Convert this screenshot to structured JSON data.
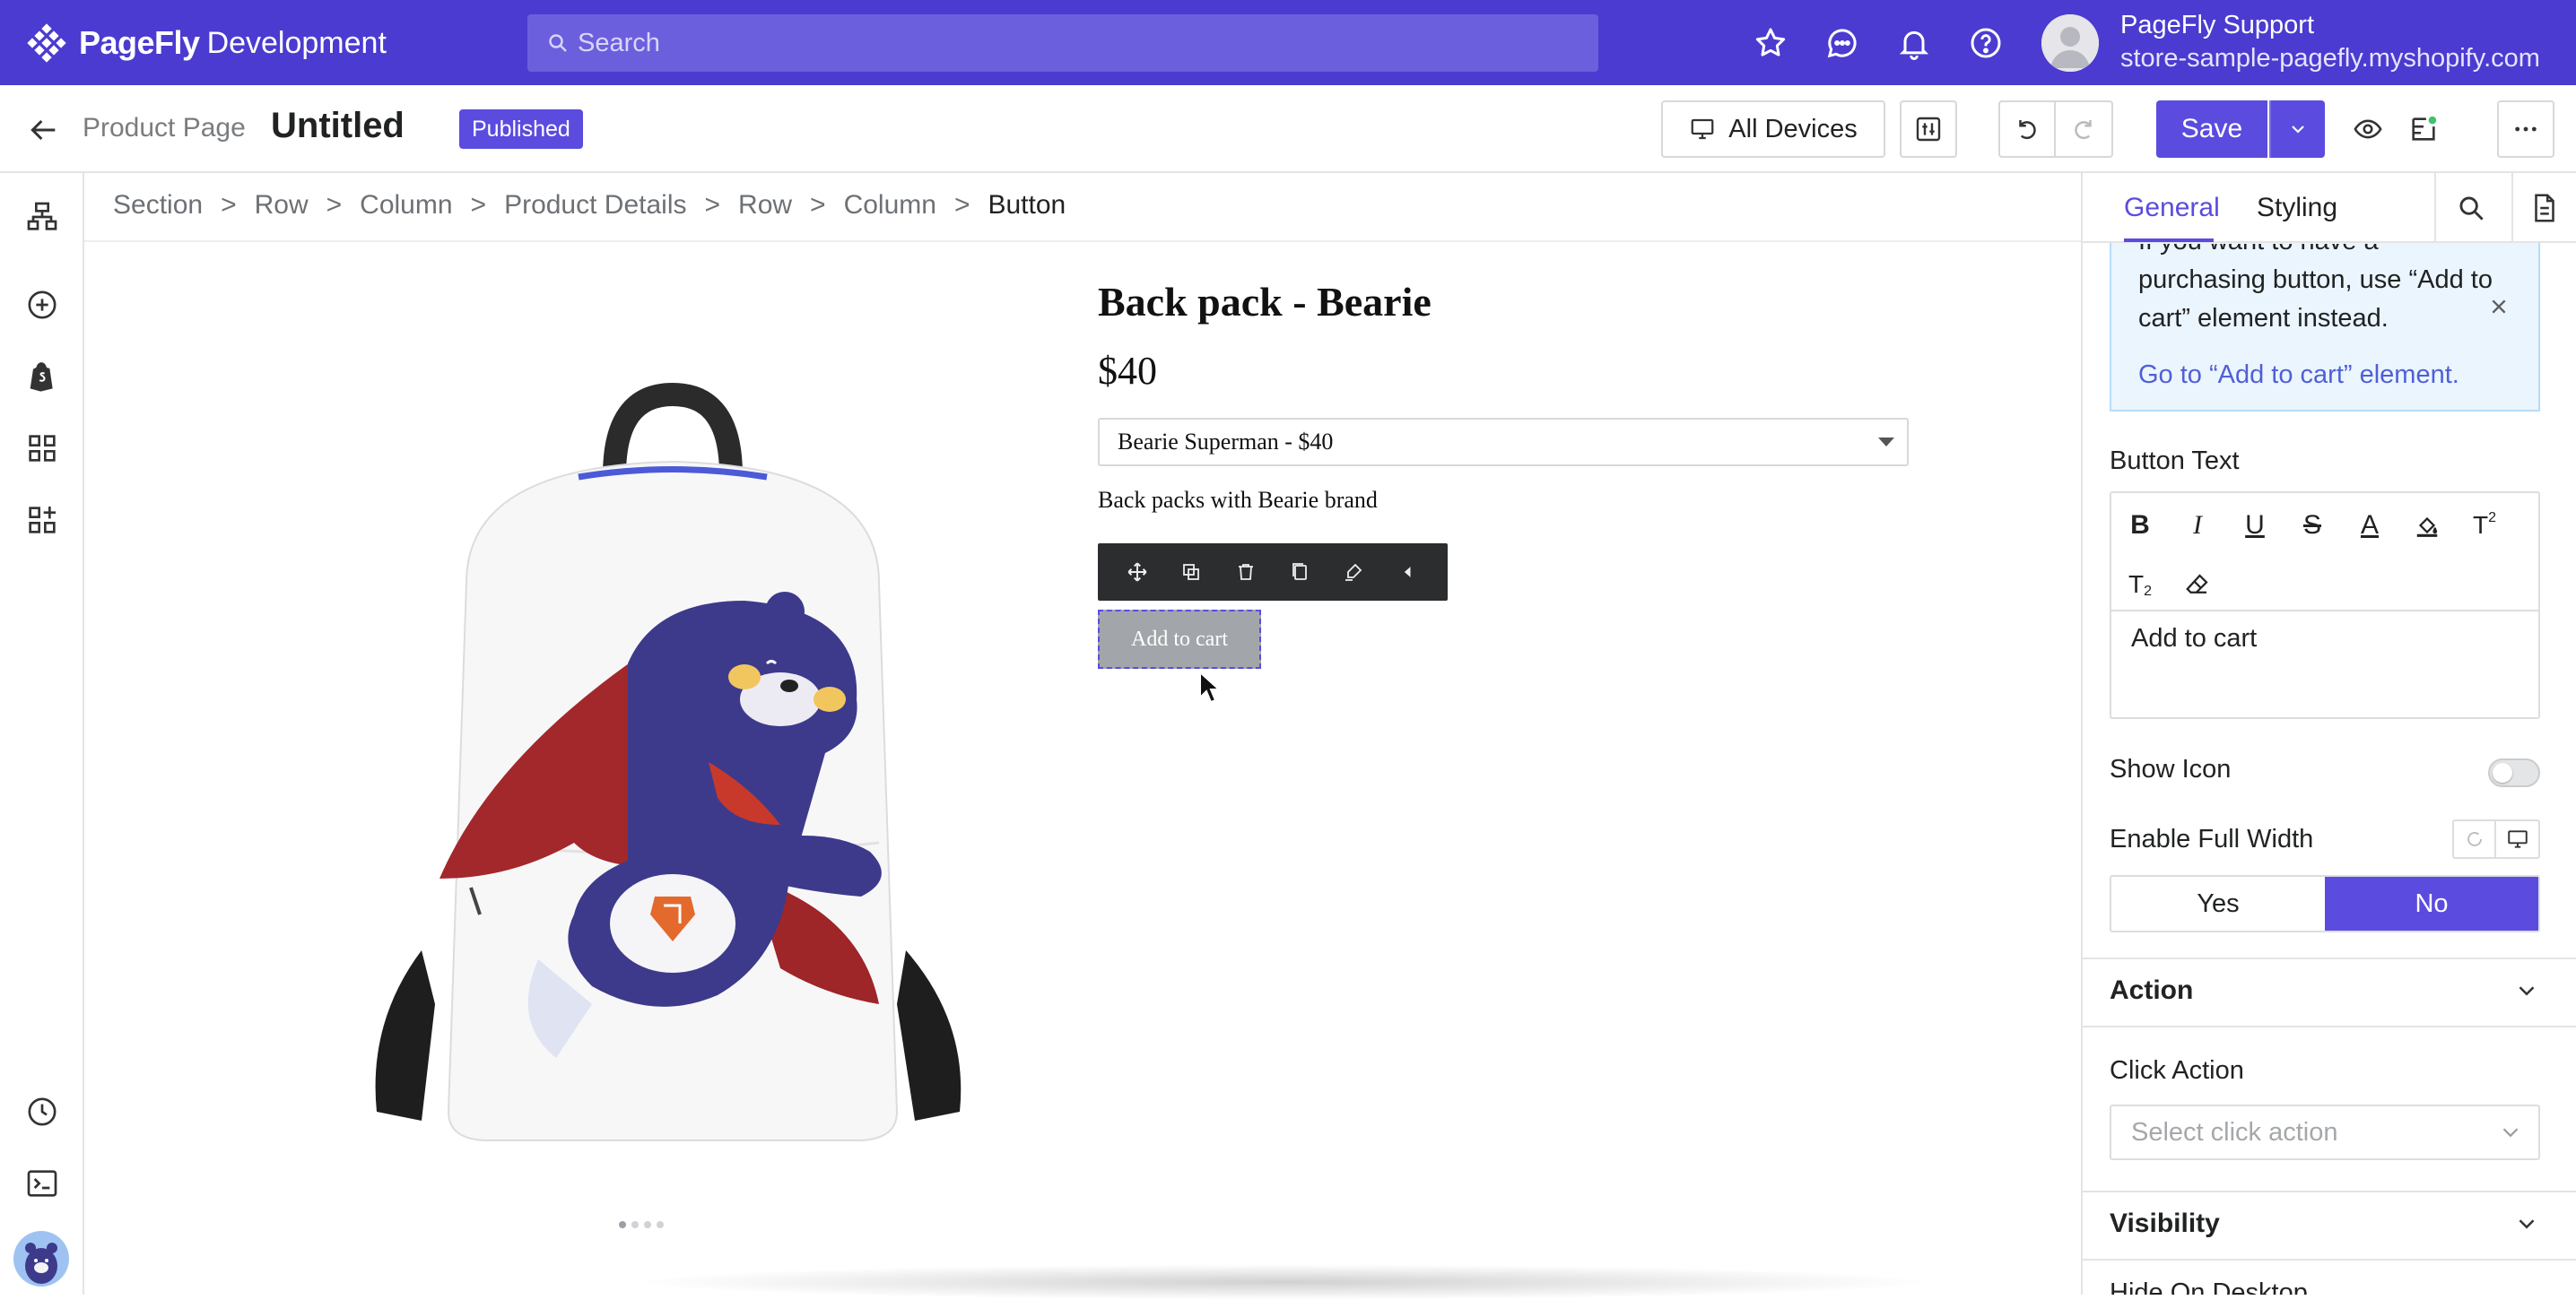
{
  "app": {
    "brand": "PageFly",
    "environment": "Development",
    "search_placeholder": "Search",
    "user_name": "PageFly Support",
    "user_store": "store-sample-pagefly.myshopify.com"
  },
  "header": {
    "page_type": "Product Page",
    "page_title": "Untitled",
    "status_badge": "Published",
    "device_label": "All Devices",
    "save_label": "Save"
  },
  "breadcrumb": [
    "Section",
    "Row",
    "Column",
    "Product Details",
    "Row",
    "Column",
    "Button"
  ],
  "canvas": {
    "product_title": "Back pack - Bearie",
    "price": "$40",
    "variant_selected": "Bearie Superman - $40",
    "description": "Back packs with Bearie brand",
    "button_text": "Add to cart",
    "carousel_dots": 4,
    "carousel_active": 1
  },
  "panel": {
    "tabs": [
      "General",
      "Styling"
    ],
    "active_tab": "General",
    "notice_text": "If you want to have a purchasing button, use “Add to cart” element instead.",
    "notice_link": "Go to “Add to cart” element.",
    "button_text_label": "Button Text",
    "button_text_value": "Add to cart",
    "show_icon_label": "Show Icon",
    "show_icon_on": false,
    "full_width_label": "Enable Full Width",
    "yes_label": "Yes",
    "no_label": "No",
    "full_width_selected": "No",
    "action_title": "Action",
    "click_action_label": "Click Action",
    "click_action_placeholder": "Select click action",
    "visibility_title": "Visibility",
    "hide_on_desktop_label": "Hide On Desktop"
  },
  "colors": {
    "brand_purple": "#4b3bd0",
    "accent": "#5b4bdf",
    "notice_bg": "#ebf5fd"
  }
}
